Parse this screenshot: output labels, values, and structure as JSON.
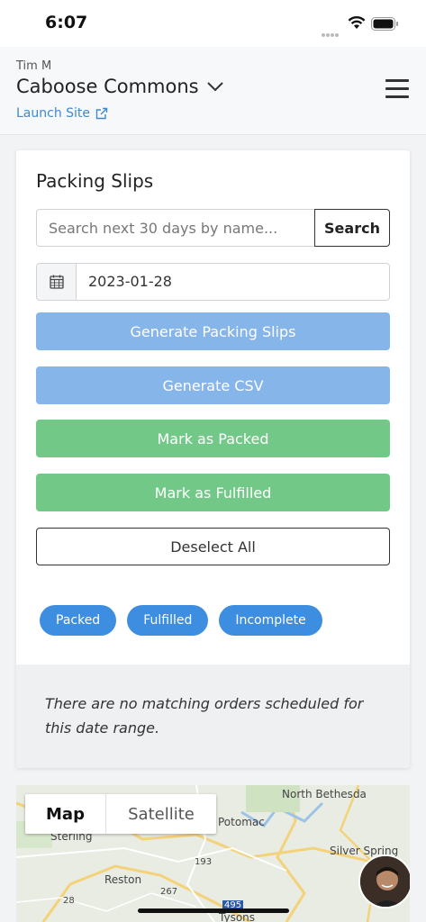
{
  "status_bar": {
    "time": "6:07"
  },
  "header": {
    "user_name": "Tim M",
    "site_name": "Caboose Commons",
    "launch_link": "Launch Site"
  },
  "packing": {
    "title": "Packing Slips",
    "search_placeholder": "Search next 30 days by name...",
    "search_button": "Search",
    "date_value": "2023-01-28",
    "buttons": {
      "generate_slips": "Generate Packing Slips",
      "generate_csv": "Generate CSV",
      "mark_packed": "Mark as Packed",
      "mark_fulfilled": "Mark as Fulfilled",
      "deselect_all": "Deselect All"
    },
    "filters": [
      "Packed",
      "Fulfilled",
      "Incomplete"
    ],
    "empty_message": "There are no matching orders scheduled for this date range."
  },
  "map": {
    "tabs": {
      "map": "Map",
      "satellite": "Satellite"
    },
    "labels": {
      "north_bethesda": "North Bethesda",
      "potomac": "Potomac",
      "sterling": "Sterling",
      "silver_spring": "Silver Spring",
      "reston": "Reston",
      "tysons": "Tysons",
      "route_193": "193",
      "route_267": "267",
      "route_28": "28",
      "route_495": "495"
    }
  },
  "colors": {
    "accent_blue": "#3d8de0",
    "button_blue": "#86b5ea",
    "button_green": "#72c886",
    "link": "#3a8ad6"
  }
}
